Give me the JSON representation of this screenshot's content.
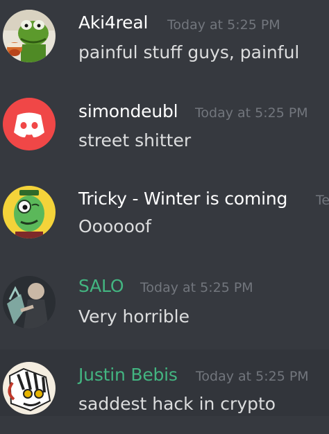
{
  "colors": {
    "background": "#36393f",
    "username_default": "#ffffff",
    "username_green": "#43b581",
    "timestamp": "#72767d",
    "message_text": "#dcddde",
    "discord_red": "#f04747"
  },
  "messages": [
    {
      "username": "Aki4real",
      "timestamp": "Today at 5:25 PM",
      "text": "painful stuff guys, painful",
      "avatar_icon": "kermit-tea-avatar",
      "name_color": "#ffffff"
    },
    {
      "username": "simondeubl",
      "timestamp": "Today at 5:25 PM",
      "text": "street shitter",
      "avatar_icon": "discord-logo-avatar",
      "name_color": "#ffffff"
    },
    {
      "username": "Tricky - Winter is coming",
      "timestamp": "Te",
      "text": "Oooooof",
      "avatar_icon": "green-monster-avatar",
      "name_color": "#ffffff"
    },
    {
      "username": "SALO",
      "timestamp": "Today at 5:25 PM",
      "text": "Very horrible",
      "avatar_icon": "statue-of-liberty-avatar",
      "name_color": "#43b581"
    },
    {
      "username": "Justin Bebis",
      "timestamp": "Today at 5:25 PM",
      "text": "saddest hack in crypto",
      "avatar_icon": "cartoon-zebra-avatar",
      "name_color": "#43b581"
    }
  ]
}
